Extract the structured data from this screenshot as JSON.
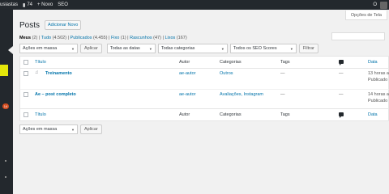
{
  "adminbar": {
    "site_name": "usiastas",
    "comments_count": "74",
    "new_label": "+ Novo",
    "seo_label": "SEO",
    "user_initial": "O"
  },
  "sidemenu": {
    "badge_count": "14"
  },
  "header": {
    "title": "Posts",
    "add_new_label": "Adicionar Novo",
    "screen_options_label": "Opções de Tela"
  },
  "filters": {
    "views": [
      {
        "label": "Meus",
        "count": "(2)"
      },
      {
        "label": "Tudo",
        "count": "(4.502)"
      },
      {
        "label": "Publicados",
        "count": "(4.455)"
      },
      {
        "label": "Fixo",
        "count": "(1)"
      },
      {
        "label": "Rascunhos",
        "count": "(47)"
      },
      {
        "label": "Lixos",
        "count": "(167)"
      }
    ]
  },
  "tablenav_top": {
    "bulk_actions": "Ações em massa",
    "apply_label": "Aplicar",
    "dates": "Todas as datas",
    "categories": "Todas categorias",
    "seo_scores": "Todos os SEO Scores",
    "filter_label": "Filtrar"
  },
  "table": {
    "columns": {
      "title": "Título",
      "author": "Autor",
      "categories": "Categorias",
      "tags": "Tags",
      "date": "Data"
    },
    "rows": [
      {
        "title": "Treinamento",
        "author": "ae-autor",
        "categories": "Outros",
        "tags": "—",
        "comments": "—",
        "date_line1": "13 horas a",
        "date_line2": "Publicado"
      },
      {
        "title": "Ae – post completo",
        "author": "ae-autor",
        "categories": "Avaliações, Instagram",
        "tags": "—",
        "comments": "—",
        "date_line1": "14 horas a",
        "date_line2": "Publicado"
      }
    ]
  },
  "tablenav_bottom": {
    "bulk_actions": "Ações em massa",
    "apply_label": "Aplicar"
  },
  "icons": {
    "comments": "comment-bubble-icon",
    "audio_format": "music-note-icon"
  }
}
